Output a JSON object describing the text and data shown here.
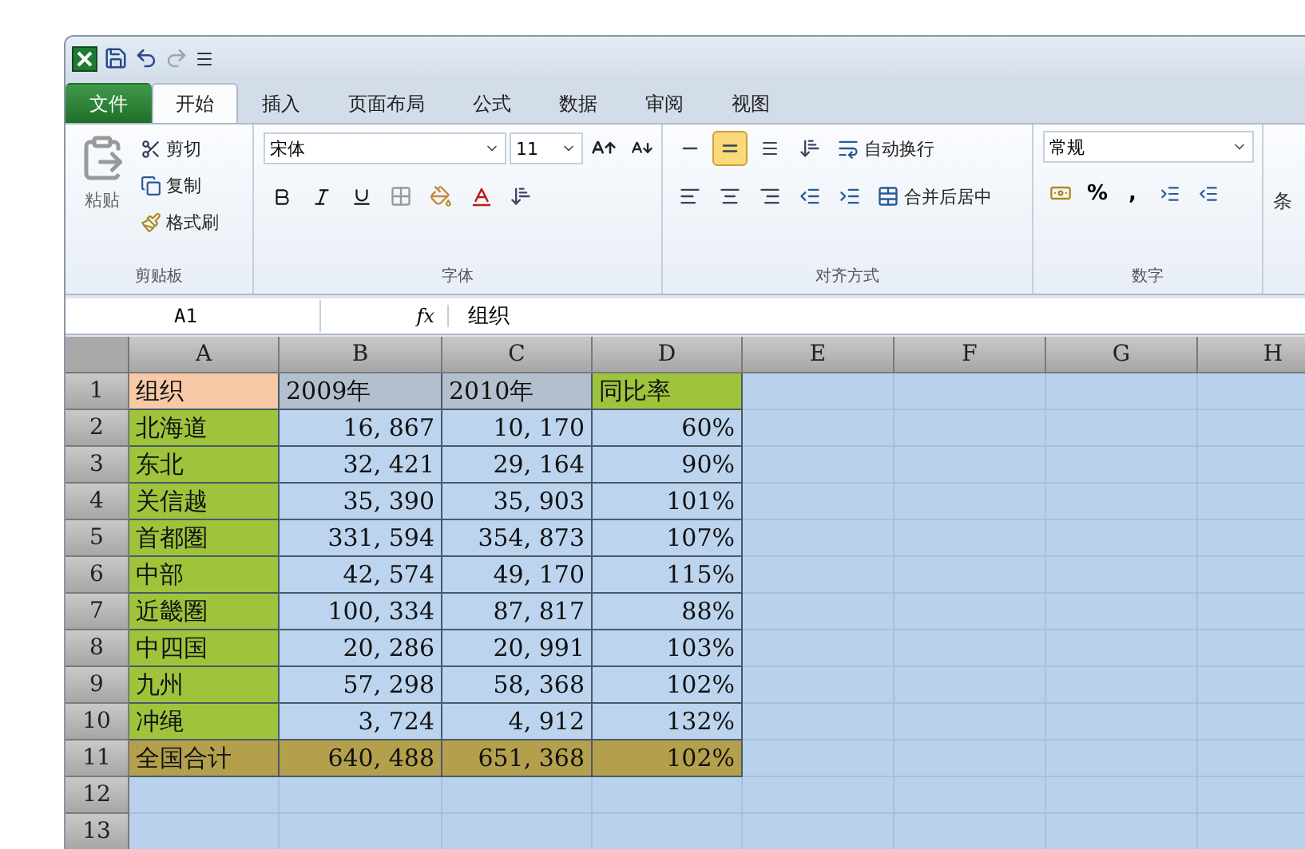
{
  "tabs": [
    {
      "label": "文件",
      "kind": "file",
      "selected": false
    },
    {
      "label": "开始",
      "kind": "tab",
      "selected": true
    },
    {
      "label": "插入",
      "kind": "tab",
      "selected": false
    },
    {
      "label": "页面布局",
      "kind": "tab",
      "selected": false
    },
    {
      "label": "公式",
      "kind": "tab",
      "selected": false
    },
    {
      "label": "数据",
      "kind": "tab",
      "selected": false
    },
    {
      "label": "审阅",
      "kind": "tab",
      "selected": false
    },
    {
      "label": "视图",
      "kind": "tab",
      "selected": false
    }
  ],
  "clipboard": {
    "paste": "粘贴",
    "cut": "剪切",
    "copy": "复制",
    "format_painter": "格式刷",
    "label": "剪贴板"
  },
  "font": {
    "name": "宋体",
    "size": "11",
    "label": "字体"
  },
  "alignment": {
    "vertical_align": [
      {
        "selected": false
      },
      {
        "selected": true
      },
      {
        "selected": false
      }
    ],
    "wrap": "自动换行",
    "merge": "合并后居中",
    "label": "对齐方式"
  },
  "number": {
    "format": "常规",
    "percent": "%",
    "comma": ",",
    "label": "数字"
  },
  "next_group": "条",
  "formula_bar": {
    "name_box": "A1",
    "fx": "fx",
    "value": "组织"
  },
  "sheet": {
    "columns": [
      "A",
      "B",
      "C",
      "D",
      "E",
      "F",
      "G",
      "H"
    ],
    "rows": [
      {
        "number": "1",
        "kind": "header",
        "cells": [
          "组织",
          "2009年",
          "2010年",
          "同比率"
        ]
      },
      {
        "number": "2",
        "kind": "data",
        "cells": [
          "北海道",
          "16, 867",
          "10, 170",
          "60%"
        ]
      },
      {
        "number": "3",
        "kind": "data",
        "cells": [
          "东北",
          "32, 421",
          "29, 164",
          "90%"
        ]
      },
      {
        "number": "4",
        "kind": "data",
        "cells": [
          "关信越",
          "35, 390",
          "35, 903",
          "101%"
        ]
      },
      {
        "number": "5",
        "kind": "data",
        "cells": [
          "首都圏",
          "331, 594",
          "354, 873",
          "107%"
        ]
      },
      {
        "number": "6",
        "kind": "data",
        "cells": [
          "中部",
          "42, 574",
          "49, 170",
          "115%"
        ]
      },
      {
        "number": "7",
        "kind": "data",
        "cells": [
          "近畿圏",
          "100, 334",
          "87, 817",
          "88%"
        ]
      },
      {
        "number": "8",
        "kind": "data",
        "cells": [
          "中四国",
          "20, 286",
          "20, 991",
          "103%"
        ]
      },
      {
        "number": "9",
        "kind": "data",
        "cells": [
          "九州",
          "57, 298",
          "58, 368",
          "102%"
        ]
      },
      {
        "number": "10",
        "kind": "data",
        "cells": [
          "冲绳",
          "3, 724",
          "4, 912",
          "132%"
        ]
      },
      {
        "number": "11",
        "kind": "total",
        "cells": [
          "全国合计",
          "640, 488",
          "651, 368",
          "102%"
        ]
      },
      {
        "number": "12",
        "kind": "empty",
        "cells": []
      },
      {
        "number": "13",
        "kind": "empty",
        "cells": []
      }
    ]
  }
}
